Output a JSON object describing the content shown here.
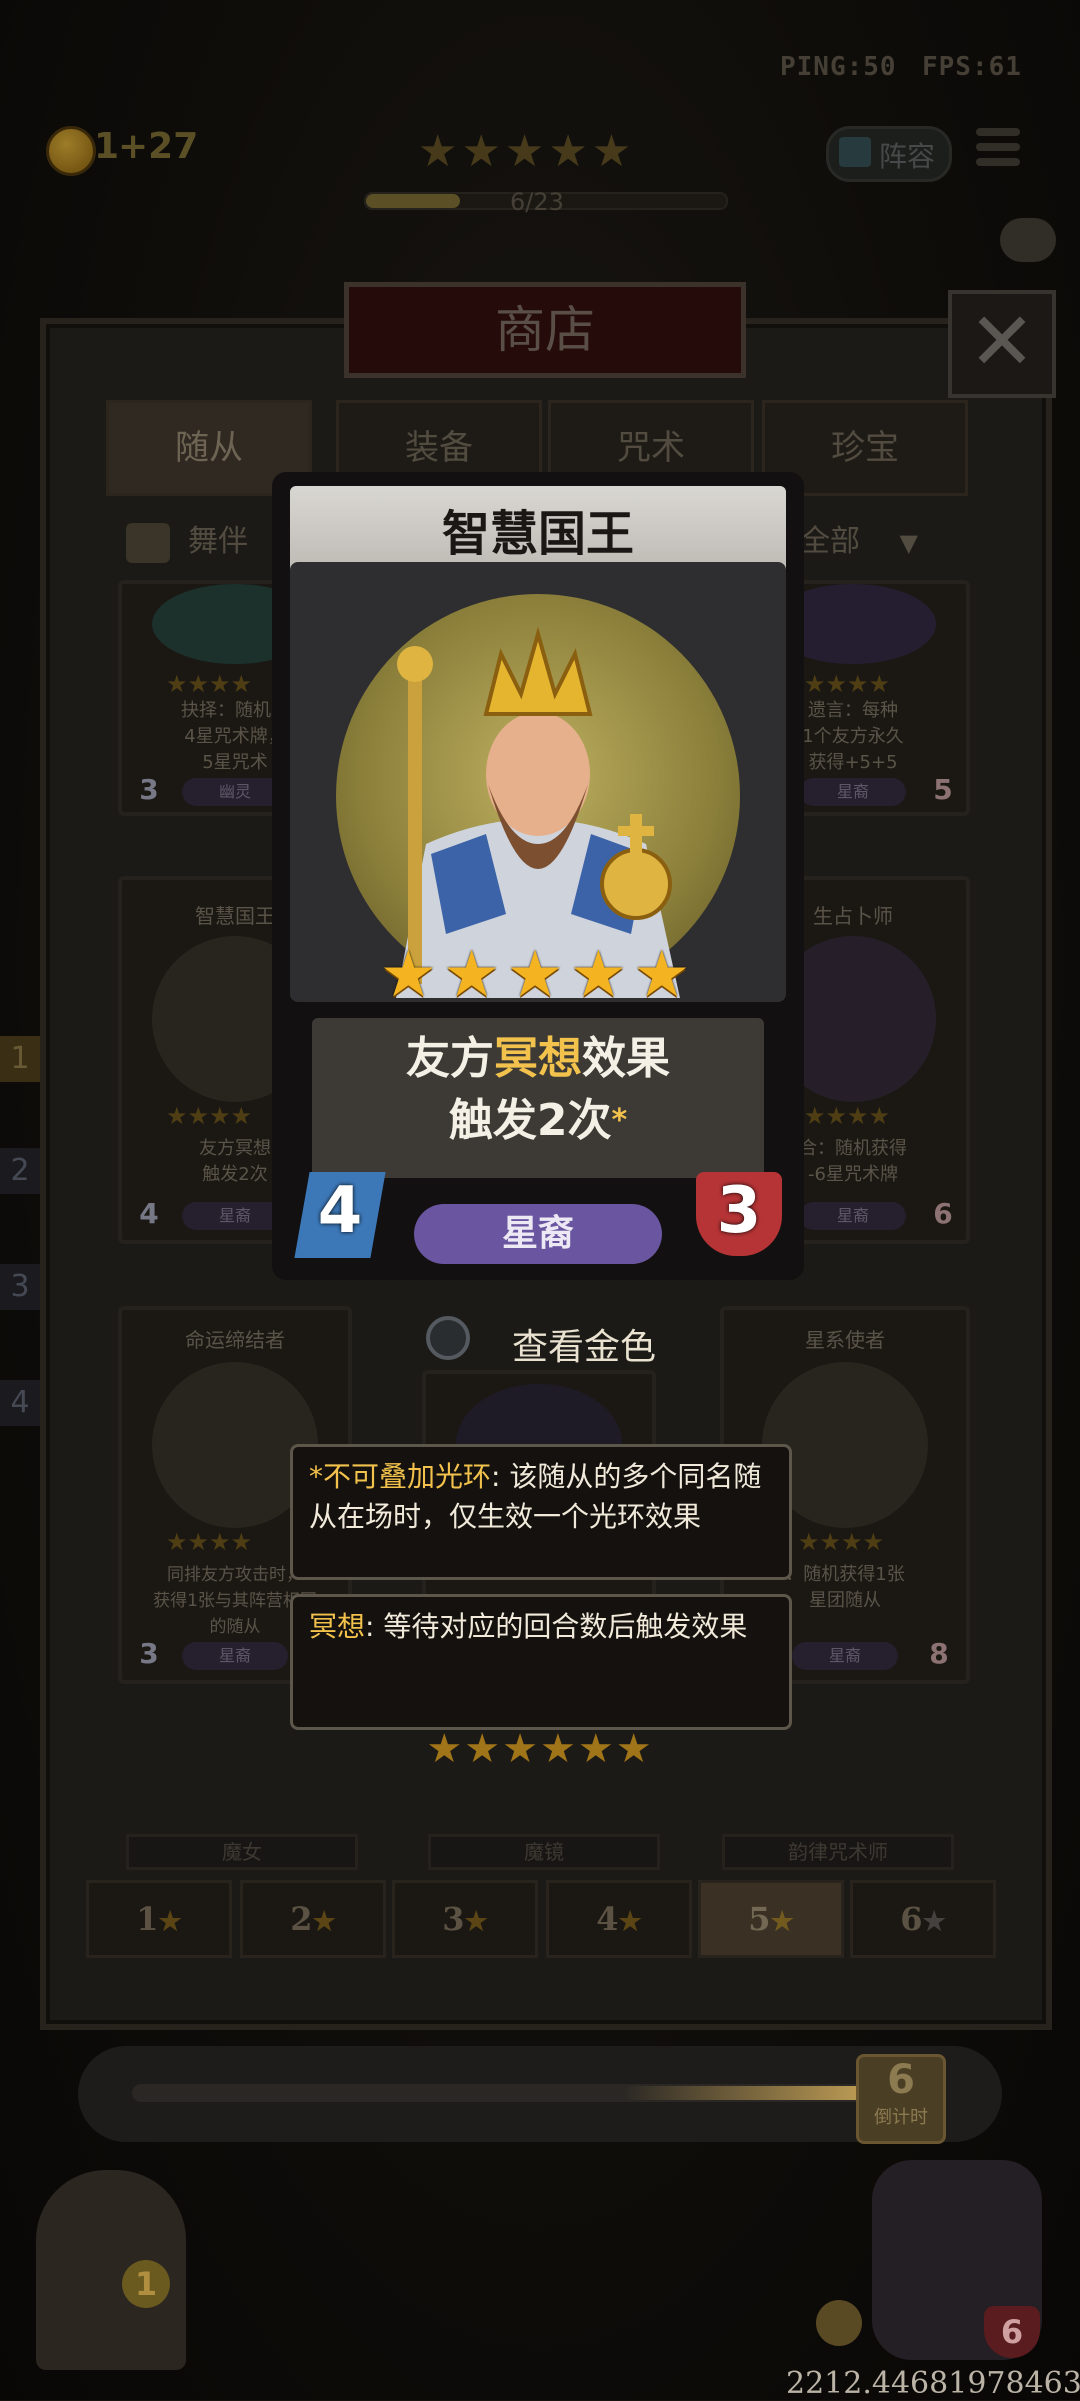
{
  "hud": {
    "ping": "PING:50",
    "fps": "FPS:61",
    "gold": "1",
    "gold_gain": "+27",
    "progress_text": "6/23",
    "progress_fraction": 0.26,
    "lineup_label": "阵容",
    "stars": 5
  },
  "shop": {
    "title": "商店",
    "tabs": [
      "随从",
      "装备",
      "咒术",
      "珍宝"
    ],
    "active_tab": 0,
    "filter_left": "舞伴",
    "filter_right": "全部"
  },
  "cards": [
    {
      "name": "",
      "text": "抉择：随机获\n4星咒术牌，\n5星咒术",
      "tribe": "幽灵",
      "attack": "3",
      "health": ""
    },
    {
      "name": "",
      "text": "遗言：每种\n1个友方永久\n获得+5+5",
      "tribe": "星裔",
      "attack": "",
      "health": "5"
    },
    {
      "name": "智慧国王",
      "text": "友方冥想\n触发2次",
      "tribe": "星裔",
      "attack": "4",
      "health": ""
    },
    {
      "name": "生占卜师",
      "text": "合：随机获得\n-6星咒术牌",
      "tribe": "星裔",
      "attack": "",
      "health": "6"
    },
    {
      "name": "命运缔结者",
      "text": "同排友方攻击时，\n获得1张与其阵营相同\n的随从",
      "tribe": "星裔",
      "attack": "3",
      "health": ""
    },
    {
      "name": "星系使者",
      "text": "：随机获得1张\n星团随从",
      "tribe": "星裔",
      "attack": "",
      "health": "8"
    }
  ],
  "bottom_row_names": [
    "魔女",
    "魔镜",
    "韵律咒术师"
  ],
  "star_filters": [
    "1",
    "2",
    "3",
    "4",
    "5",
    "6"
  ],
  "active_star_filter": 4,
  "side_numbers": [
    "1",
    "2",
    "3",
    "4"
  ],
  "featured": {
    "name": "智慧国王",
    "stars": 5,
    "desc_pre": "友方",
    "desc_keyword": "冥想",
    "desc_post": "效果",
    "desc_line2": "触发2次",
    "desc_mark": "*",
    "tribe": "星裔",
    "attack": "4",
    "health": "3"
  },
  "view_gold_label": "查看金色",
  "tooltips": {
    "aura_keyword": "*不可叠加光环",
    "aura_text": ": 该随从的多个同名随从在场时，仅生效一个光环效果",
    "meditate_keyword": "冥想",
    "meditate_text": ": 等待对应的回合数后触发效果"
  },
  "star_row_under_tooltips": 6,
  "timer": {
    "value": "6",
    "label": "倒计时"
  },
  "footer_number": "2212.44681978463",
  "player_health": "6",
  "bottom_left_badge": "1"
}
